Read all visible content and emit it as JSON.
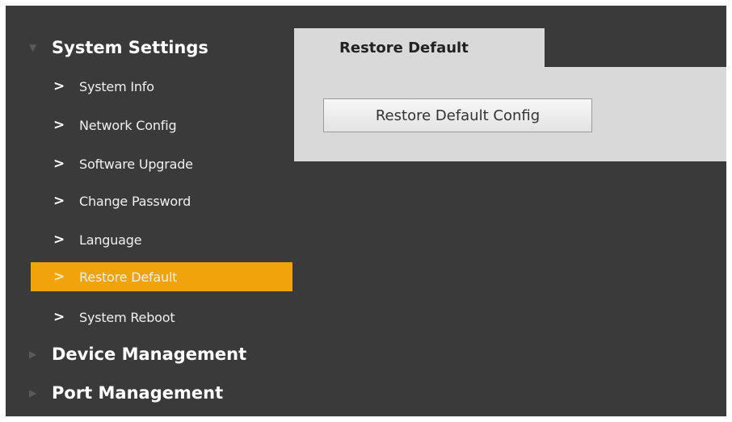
{
  "sidebar": {
    "sections": [
      {
        "label": "System Settings",
        "icon": "triangle-down-icon"
      },
      {
        "label": "Device Management",
        "icon": "triangle-right-icon"
      },
      {
        "label": "Port Management",
        "icon": "triangle-right-icon"
      }
    ],
    "items": [
      {
        "label": "System Info"
      },
      {
        "label": "Network Config"
      },
      {
        "label": "Software Upgrade"
      },
      {
        "label": "Change Password"
      },
      {
        "label": "Language"
      },
      {
        "label": "Restore Default",
        "active": true
      },
      {
        "label": "System Reboot"
      }
    ],
    "chevron": ">",
    "active_color": "#f0a30a"
  },
  "main": {
    "tab_label": "Restore Default",
    "button_label": "Restore Default Config"
  }
}
